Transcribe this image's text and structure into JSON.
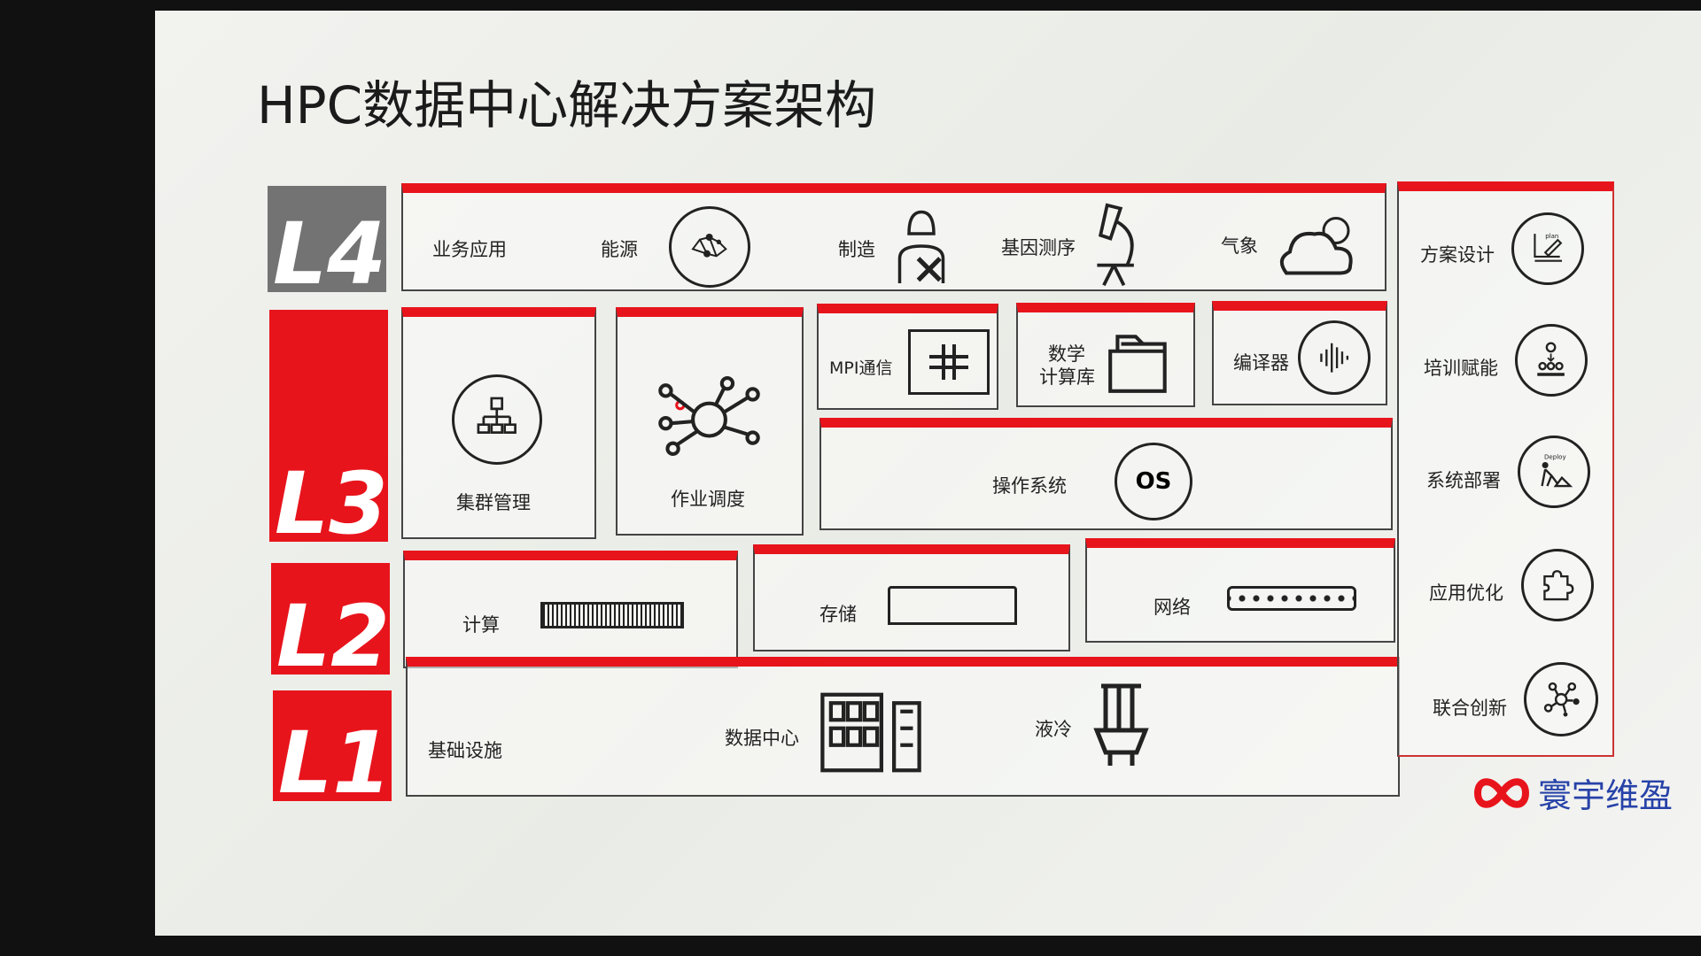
{
  "title": "HPC数据中心解决方案架构",
  "layers": {
    "l4": "L4",
    "l3": "L3",
    "l2": "L2",
    "l1": "L1"
  },
  "l4": {
    "label": "业务应用",
    "items": [
      "能源",
      "制造",
      "基因测序",
      "气象"
    ]
  },
  "l3": {
    "cluster": "集群管理",
    "job": "作业调度",
    "mpi": "MPI通信",
    "math_line1": "数学",
    "math_line2": "计算库",
    "compiler": "编译器",
    "os": "操作系统",
    "os_icon": "OS"
  },
  "l2": {
    "compute": "计算",
    "storage": "存储",
    "network": "网络"
  },
  "l1": {
    "label": "基础设施",
    "datacenter": "数据中心",
    "cooling": "液冷"
  },
  "services": [
    "方案设计",
    "培训赋能",
    "系统部署",
    "应用优化",
    "联合创新"
  ],
  "service_icon_text": {
    "plan": "plan",
    "deploy": "Deploy"
  },
  "logo": {
    "text": "寰宇维盈",
    "color": "#2742a8"
  },
  "colors": {
    "accent": "#e8141c",
    "layer_l4": "#737373"
  }
}
